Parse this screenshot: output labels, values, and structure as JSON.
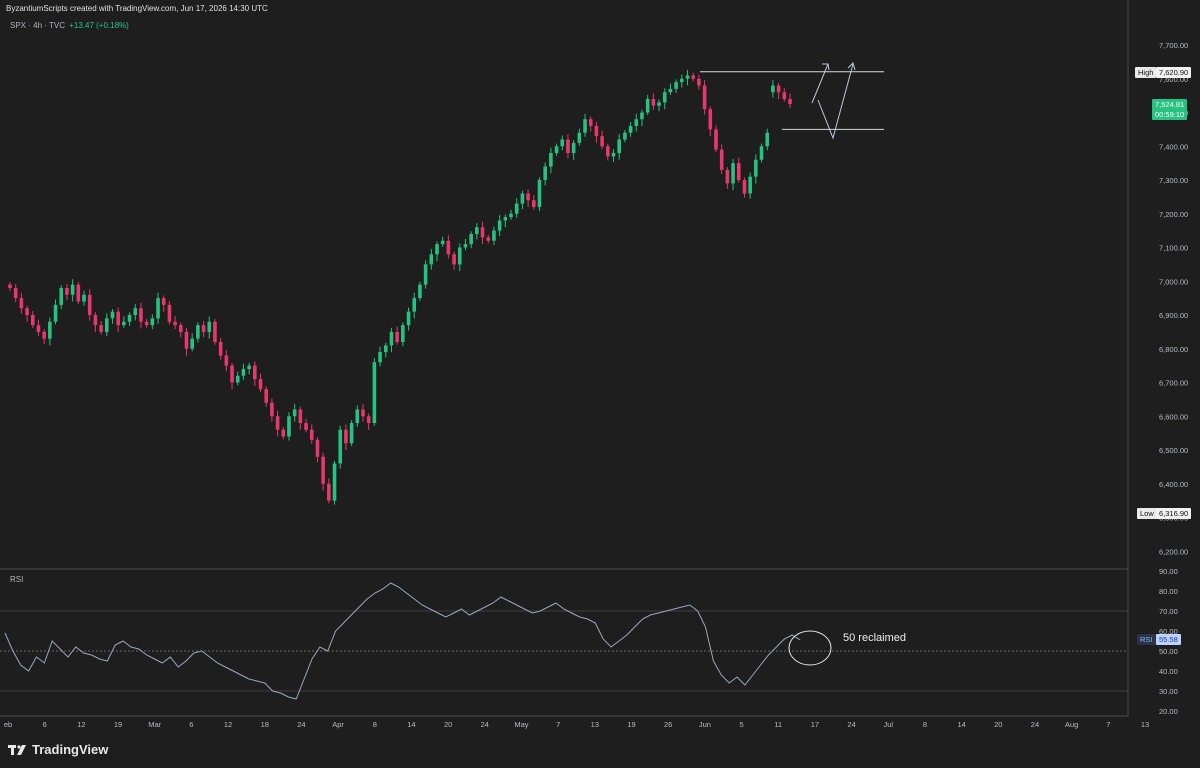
{
  "header": {
    "attribution": "ByzantiumScripts created with TradingView.com, Jun 17, 2026 14:30 UTC",
    "symbol_line": "SPX · 4h · TVC",
    "change": "+13.47 (+0.18%)"
  },
  "price_axis": {
    "labels": [
      "7,700.00",
      "7,600.00",
      "7,500.00",
      "7,400.00",
      "7,300.00",
      "7,200.00",
      "7,100.00",
      "7,000.00",
      "6,900.00",
      "6,800.00",
      "6,700.00",
      "6,600.00",
      "6,500.00",
      "6,400.00",
      "6,300.00",
      "6,200.00"
    ],
    "high_label": "High",
    "high_value": "7,620.90",
    "low_label": "Low",
    "low_value": "6,316.90",
    "last_value": "7,524.81",
    "countdown": "00:59:10",
    "last_color": "#26c281"
  },
  "rsi_panel": {
    "title": "RSI",
    "axis_labels": [
      "90.00",
      "80.00",
      "70.00",
      "60.00",
      "50.00",
      "40.00",
      "30.00",
      "20.00"
    ],
    "tag_label": "RSI",
    "tag_value": "55.58",
    "annotation": "50 reclaimed",
    "line_color": "#9aa7bd"
  },
  "time_axis": {
    "labels": [
      "eb",
      "6",
      "12",
      "19",
      "Mar",
      "6",
      "12",
      "18",
      "24",
      "Apr",
      "8",
      "14",
      "20",
      "24",
      "May",
      "7",
      "13",
      "19",
      "26",
      "Jun",
      "5",
      "11",
      "17",
      "24",
      "Jul",
      "8",
      "14",
      "20",
      "24",
      "Aug",
      "7",
      "13"
    ]
  },
  "logo": {
    "text": "TradingView"
  },
  "colors": {
    "up": "#26c281",
    "down": "#e9366e",
    "background": "#1e1e1e",
    "grid": "#3a3a3a"
  },
  "chart_data": [
    {
      "type": "candlestick",
      "title": "SPX · 4h · TVC",
      "ylim": [
        6150,
        7760
      ],
      "key_levels": [
        7620.9,
        7450
      ],
      "x_start_label": "Feb",
      "close": [
        6980,
        6950,
        6920,
        6900,
        6870,
        6850,
        6830,
        6880,
        6930,
        6980,
        6960,
        6990,
        6940,
        6960,
        6900,
        6870,
        6850,
        6890,
        6910,
        6870,
        6880,
        6900,
        6920,
        6880,
        6870,
        6890,
        6950,
        6930,
        6880,
        6870,
        6850,
        6800,
        6830,
        6870,
        6850,
        6880,
        6820,
        6780,
        6750,
        6700,
        6720,
        6740,
        6750,
        6710,
        6680,
        6640,
        6600,
        6560,
        6540,
        6600,
        6620,
        6580,
        6560,
        6530,
        6480,
        6400,
        6350,
        6460,
        6560,
        6520,
        6580,
        6620,
        6600,
        6580,
        6760,
        6790,
        6810,
        6850,
        6820,
        6870,
        6910,
        6950,
        6990,
        7050,
        7080,
        7110,
        7120,
        7080,
        7050,
        7100,
        7110,
        7140,
        7160,
        7130,
        7120,
        7150,
        7180,
        7190,
        7200,
        7230,
        7260,
        7240,
        7220,
        7300,
        7340,
        7380,
        7400,
        7420,
        7380,
        7410,
        7440,
        7480,
        7460,
        7430,
        7400,
        7370,
        7380,
        7420,
        7440,
        7460,
        7480,
        7500,
        7540,
        7520,
        7530,
        7560,
        7570,
        7590,
        7600,
        7610,
        7600,
        7580,
        7510,
        7450,
        7390,
        7330,
        7290,
        7350,
        7300,
        7260,
        7310,
        7360,
        7400,
        7440,
        7580,
        7560,
        7540,
        7525
      ]
    },
    {
      "type": "line",
      "title": "RSI",
      "ylim": [
        20,
        90
      ],
      "levels": [
        70,
        50,
        30
      ],
      "values": [
        59,
        50,
        43,
        40,
        47,
        44,
        55,
        51,
        47,
        52,
        49,
        48,
        46,
        45,
        53,
        55,
        52,
        51,
        48,
        46,
        44,
        47,
        42,
        45,
        49,
        50,
        47,
        44,
        42,
        40,
        38,
        36,
        35,
        34,
        30,
        29,
        27,
        26,
        36,
        46,
        52,
        50,
        60,
        64,
        68,
        72,
        76,
        79,
        81,
        84,
        82,
        79,
        76,
        73,
        71,
        69,
        67,
        69,
        71,
        68,
        70,
        72,
        74,
        77,
        75,
        73,
        71,
        69,
        70,
        72,
        74,
        71,
        69,
        67,
        66,
        64,
        56,
        52,
        55,
        58,
        62,
        66,
        68,
        69,
        70,
        71,
        72,
        73,
        70,
        62,
        45,
        38,
        34,
        37,
        33,
        38,
        43,
        48,
        52,
        56,
        58,
        55.58
      ]
    }
  ]
}
